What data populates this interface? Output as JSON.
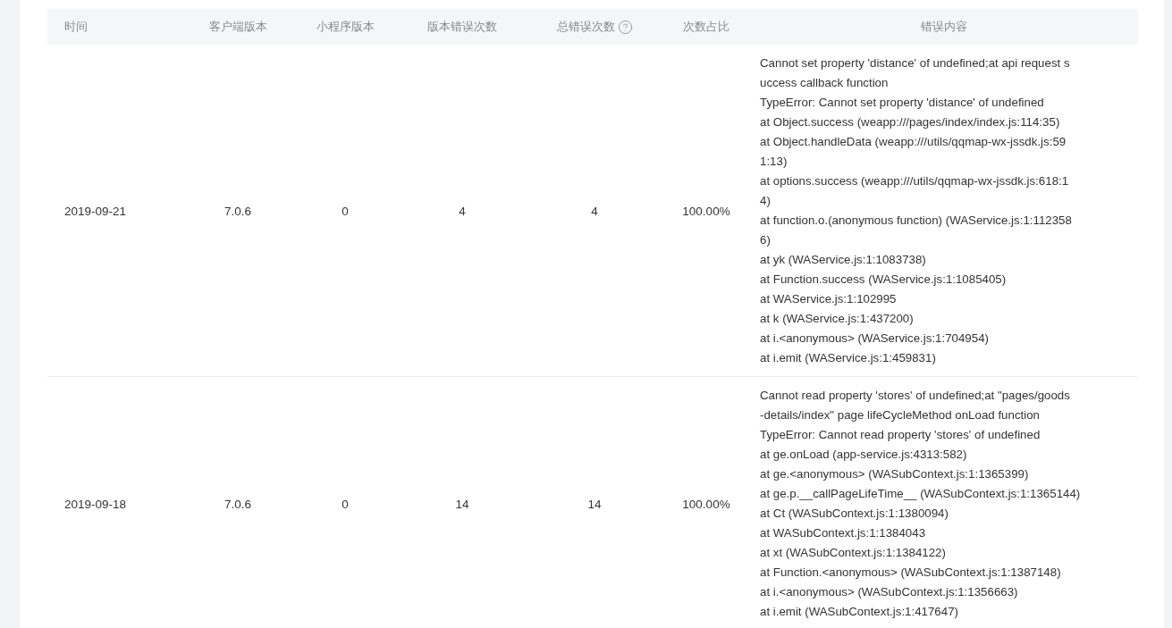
{
  "table": {
    "columns": [
      {
        "label": "时间",
        "help": false
      },
      {
        "label": "客户端版本",
        "help": false
      },
      {
        "label": "小程序版本",
        "help": false
      },
      {
        "label": "版本错误次数",
        "help": false
      },
      {
        "label": "总错误次数",
        "help": true
      },
      {
        "label": "次数占比",
        "help": false
      },
      {
        "label": "错误内容",
        "help": false
      }
    ],
    "rows": [
      {
        "time": "2019-09-21",
        "client_version": "7.0.6",
        "mini_program_version": "0",
        "version_errors": "4",
        "total_errors": "4",
        "ratio": "100.00%",
        "error_lines": [
          "Cannot set property 'distance' of undefined;at api request s",
          "uccess callback function",
          "TypeError: Cannot set property 'distance' of undefined",
          "at Object.success (weapp:///pages/index/index.js:114:35)",
          "at Object.handleData (weapp:///utils/qqmap-wx-jssdk.js:59",
          "1:13)",
          "at options.success (weapp:///utils/qqmap-wx-jssdk.js:618:1",
          "4)",
          "at function.o.(anonymous function) (WAService.js:1:112358",
          "6)",
          "at yk (WAService.js:1:1083738)",
          "at Function.success (WAService.js:1:1085405)",
          "at WAService.js:1:102995",
          "at k (WAService.js:1:437200)",
          "at i.<anonymous> (WAService.js:1:704954)",
          "at i.emit (WAService.js:1:459831)"
        ]
      },
      {
        "time": "2019-09-18",
        "client_version": "7.0.6",
        "mini_program_version": "0",
        "version_errors": "14",
        "total_errors": "14",
        "ratio": "100.00%",
        "error_lines": [
          "Cannot read property 'stores' of undefined;at \"pages/goods",
          "-details/index\" page lifeCycleMethod onLoad function",
          "TypeError: Cannot read property 'stores' of undefined",
          "at ge.onLoad (app-service.js:4313:582)",
          "at ge.<anonymous> (WASubContext.js:1:1365399)",
          "at ge.p.__callPageLifeTime__ (WASubContext.js:1:1365144)",
          "at Ct (WASubContext.js:1:1380094)",
          "at WASubContext.js:1:1384043",
          "at xt (WASubContext.js:1:1384122)",
          "at Function.<anonymous> (WASubContext.js:1:1387148)",
          "at i.<anonymous> (WASubContext.js:1:1356663)",
          "at i.emit (WASubContext.js:1:417647)"
        ]
      }
    ]
  }
}
